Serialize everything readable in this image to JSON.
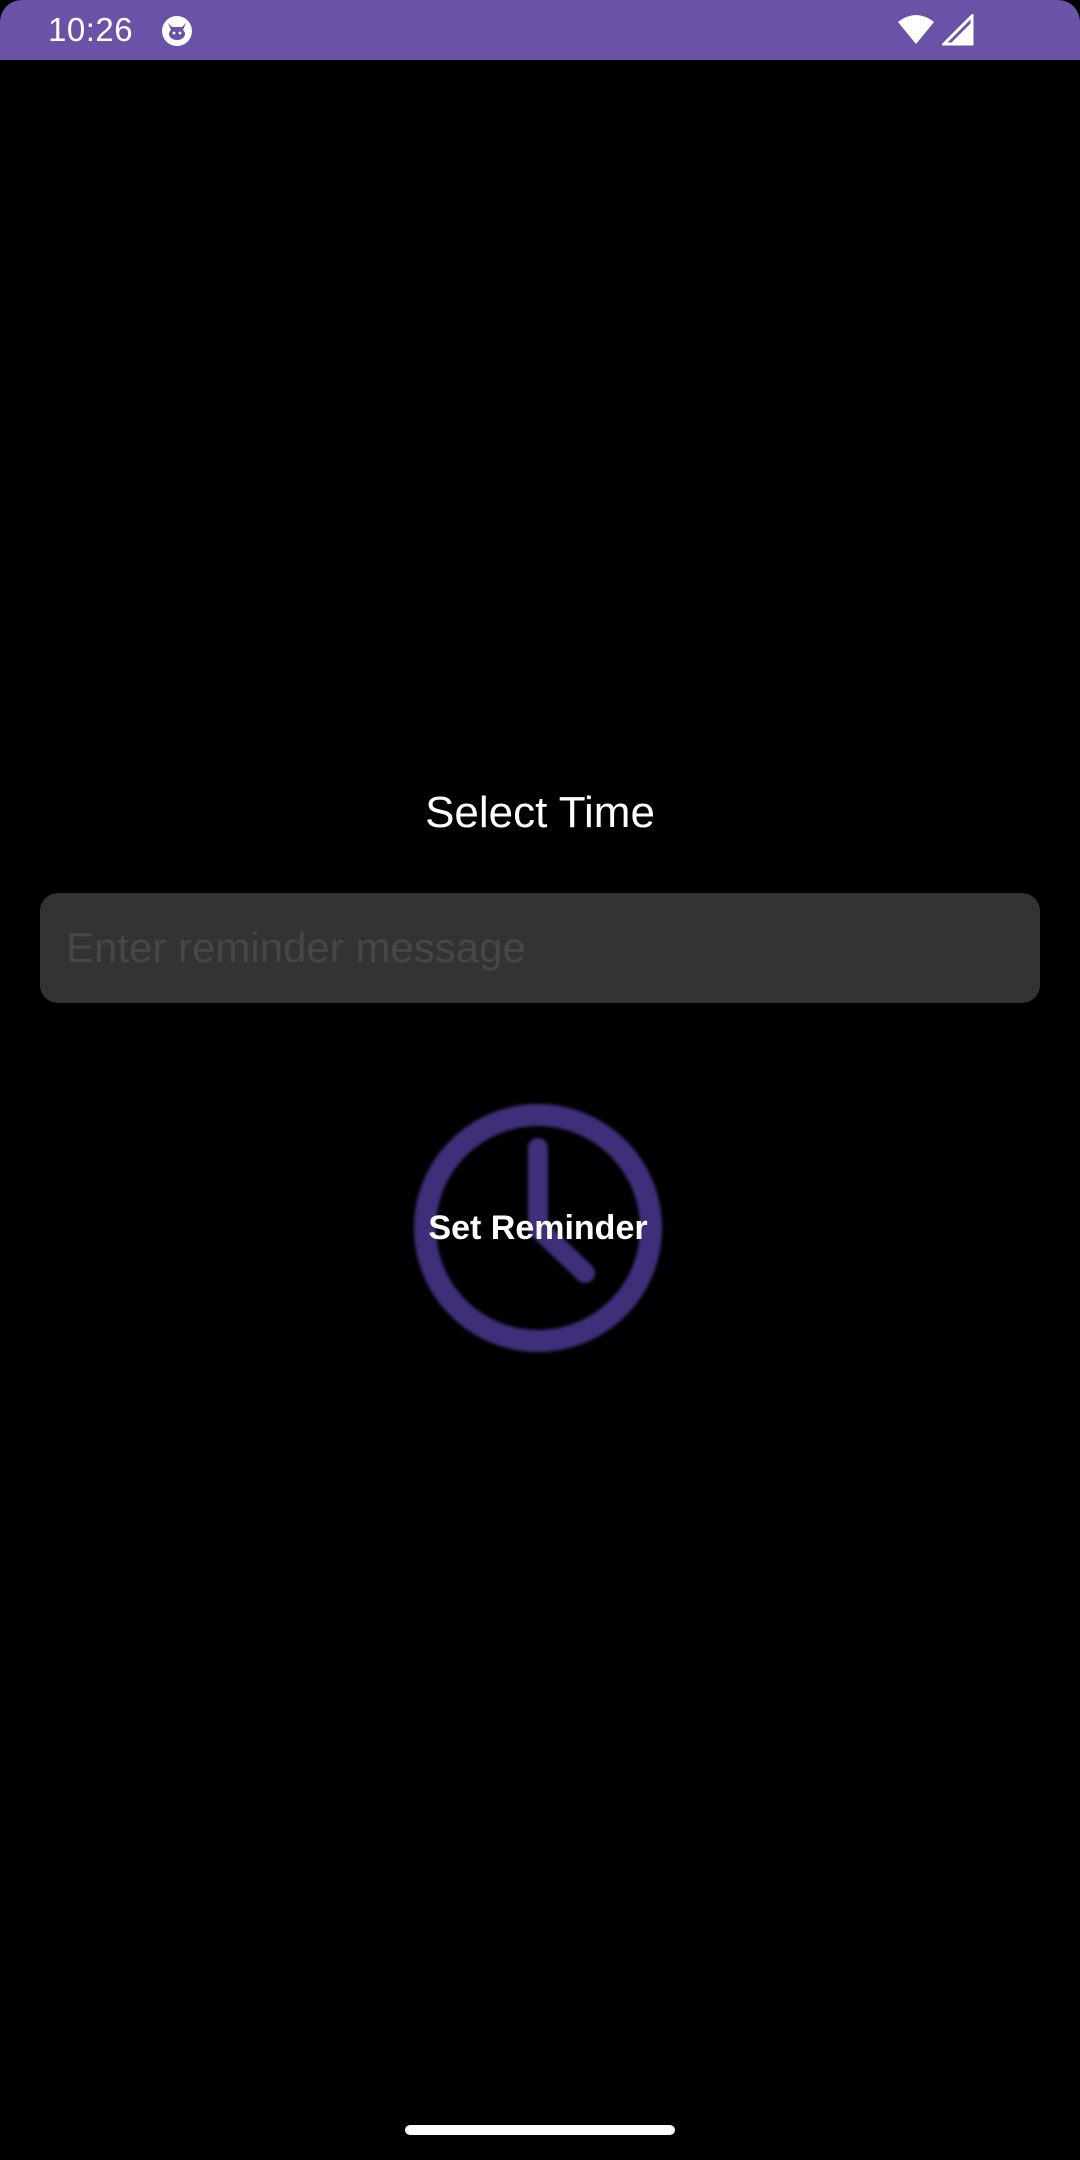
{
  "status_bar": {
    "time": "10:26",
    "app_icon": "cat-face-icon",
    "wifi_icon": "wifi-icon",
    "signal_icon": "cell-signal-icon",
    "background_color": "#6a52a6"
  },
  "main": {
    "select_time_label": "Select Time",
    "message_input": {
      "value": "",
      "placeholder": "Enter reminder message"
    },
    "set_reminder_button": {
      "label": "Set Reminder",
      "icon": "clock-icon",
      "icon_color": "#3f2f7a"
    }
  },
  "navigation": {
    "gesture_handle": "home-gesture-handle"
  }
}
